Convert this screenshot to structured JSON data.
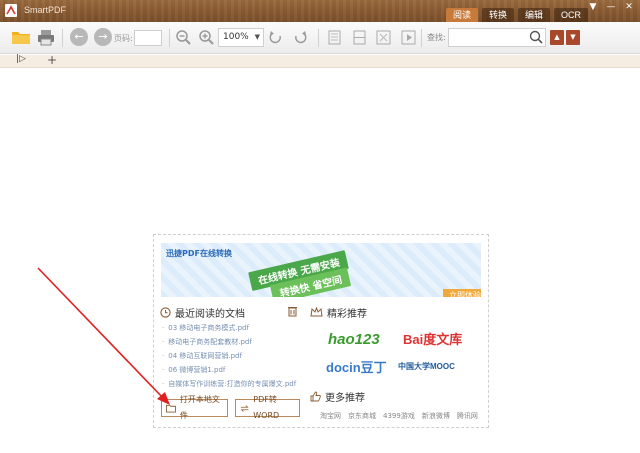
{
  "app": {
    "title": "SmartPDF"
  },
  "mode_tabs": [
    "阅读",
    "转换",
    "编辑",
    "OCR"
  ],
  "window_controls": {
    "menu": "▼",
    "minimize": "—",
    "close": "✕"
  },
  "toolbar": {
    "page_label": "页码:",
    "page_value": "",
    "zoom_value": "100%",
    "find_label": "查找:",
    "find_value": "",
    "prev_result": "▲",
    "next_result": "▼"
  },
  "tabstrip": {
    "sidebar_toggle": "|▷",
    "add_tab": "+"
  },
  "banner": {
    "title": "迅捷PDF在线转换",
    "line1": "在线转换 无需安装",
    "line2": "转换快 省空间",
    "try_button": "立即体验"
  },
  "recent": {
    "heading": "最近阅读的文档",
    "items": [
      "03 移动电子商务模式.pdf",
      "移动电子商务配套教材.pdf",
      "04 移动互联网营销.pdf",
      "06 微博营销1.pdf",
      "自媒体写作训练营:打造你的专属爆文.pdf"
    ]
  },
  "featured": {
    "heading": "精彩推荐",
    "logos": [
      "hao123",
      "Bai度文库",
      "docin豆丁",
      "中国大学MOOC"
    ]
  },
  "more": {
    "heading": "更多推荐",
    "links": [
      "淘宝网",
      "京东商城",
      "4399游戏",
      "新浪微博",
      "腾讯网"
    ]
  },
  "actions": {
    "open_local": "打开本地文件",
    "pdf_to_word": "PDF转WORD"
  },
  "colors": {
    "titlebar": "#8a5c33",
    "active_tab": "#c77a3a",
    "accent": "#a8492c",
    "arrow": "#e02020"
  }
}
